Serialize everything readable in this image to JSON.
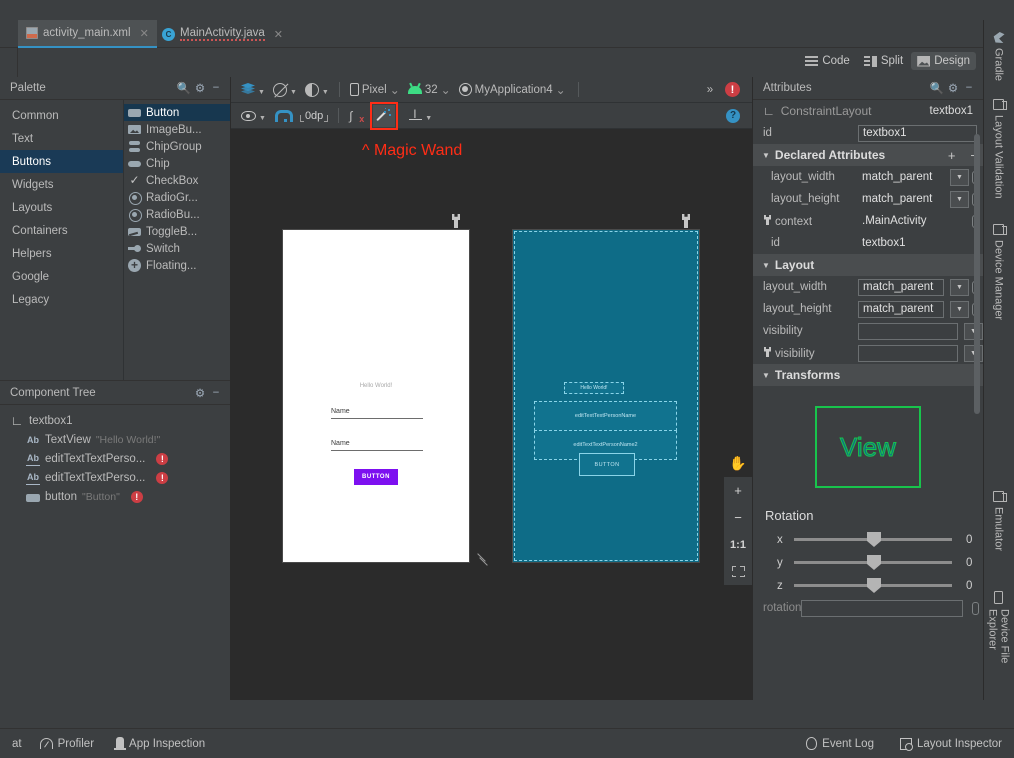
{
  "tabs": [
    {
      "label": "activity_main.xml",
      "icon": "xml-file-icon",
      "active": true
    },
    {
      "label": "MainActivity.java",
      "icon": "java-class-icon",
      "active": false
    }
  ],
  "editor_modes": [
    {
      "label": "Code",
      "icon": "code-view-icon",
      "selected": false
    },
    {
      "label": "Split",
      "icon": "split-view-icon",
      "selected": false
    },
    {
      "label": "Design",
      "icon": "design-view-icon",
      "selected": true
    }
  ],
  "palette": {
    "title": "Palette",
    "icons": [
      "search-icon",
      "gear-icon",
      "minimize-icon"
    ],
    "categories": [
      {
        "label": "Common",
        "selected": false
      },
      {
        "label": "Text",
        "selected": false
      },
      {
        "label": "Buttons",
        "selected": true
      },
      {
        "label": "Widgets",
        "selected": false
      },
      {
        "label": "Layouts",
        "selected": false
      },
      {
        "label": "Containers",
        "selected": false
      },
      {
        "label": "Helpers",
        "selected": false
      },
      {
        "label": "Google",
        "selected": false
      },
      {
        "label": "Legacy",
        "selected": false
      }
    ],
    "items": [
      {
        "label": "Button",
        "icon": "button-icon",
        "selected": true
      },
      {
        "label": "ImageBu...",
        "icon": "image-button-icon",
        "selected": false
      },
      {
        "label": "ChipGroup",
        "icon": "chip-group-icon",
        "selected": false
      },
      {
        "label": "Chip",
        "icon": "chip-icon",
        "selected": false
      },
      {
        "label": "CheckBox",
        "icon": "checkbox-icon",
        "selected": false
      },
      {
        "label": "RadioGr...",
        "icon": "radio-group-icon",
        "selected": false
      },
      {
        "label": "RadioBu...",
        "icon": "radio-button-icon",
        "selected": false
      },
      {
        "label": "ToggleB...",
        "icon": "toggle-button-icon",
        "selected": false
      },
      {
        "label": "Switch",
        "icon": "switch-icon",
        "selected": false
      },
      {
        "label": "Floating...",
        "icon": "floating-action-button-icon",
        "selected": false
      }
    ]
  },
  "component_tree": {
    "title": "Component Tree",
    "icons": [
      "gear-icon",
      "minimize-icon"
    ],
    "nodes": [
      {
        "name": "textbox1",
        "value": "",
        "icon": "constraint-layout-icon",
        "level": 0,
        "error": false
      },
      {
        "name": "TextView",
        "value": "\"Hello World!\"",
        "icon": "textview-icon",
        "level": 1,
        "error": false
      },
      {
        "name": "editTextTextPerso...",
        "value": "",
        "icon": "edittext-icon",
        "level": 1,
        "error": true
      },
      {
        "name": "editTextTextPerso...",
        "value": "",
        "icon": "edittext-icon",
        "level": 1,
        "error": true
      },
      {
        "name": "button",
        "value": "\"Button\"",
        "icon": "button-icon",
        "level": 1,
        "error": true
      }
    ]
  },
  "design_toolbar": {
    "row1": [
      {
        "name": "design-surface-mode",
        "icon": "layers-icon",
        "label": ""
      },
      {
        "name": "orientation-toggle",
        "icon": "rotate-icon",
        "label": ""
      },
      {
        "name": "night-mode-toggle",
        "icon": "theme-icon",
        "label": ""
      },
      {
        "name": "device-selector",
        "icon": "phone-icon",
        "label": "Pixel"
      },
      {
        "name": "api-selector",
        "icon": "android-icon",
        "label": "32"
      },
      {
        "name": "theme-selector",
        "icon": "theme-circle-icon",
        "label": "MyApplication4"
      }
    ],
    "overflow_label": "»",
    "error_badge": "!",
    "row2": [
      {
        "name": "view-options",
        "icon": "eye-icon",
        "label": ""
      },
      {
        "name": "autoconnect-toggle",
        "icon": "magnet-icon",
        "label": ""
      },
      {
        "name": "default-margin",
        "icon": "margin-icon",
        "label": "0dp"
      },
      {
        "name": "clear-constraints",
        "icon": "clear-constraints-icon",
        "label": ""
      },
      {
        "name": "infer-constraints",
        "icon": "magic-wand-icon",
        "label": "",
        "highlighted": true
      },
      {
        "name": "baseline-align",
        "icon": "baseline-icon",
        "label": ""
      }
    ],
    "help_badge": "?"
  },
  "annotation": {
    "text": "^ Magic Wand",
    "color": "#ff2d16"
  },
  "preview": {
    "design": {
      "hello_text": "Hello World!",
      "edit1_text": "Name",
      "edit2_text": "Name",
      "button_text": "BUTTON",
      "button_color": "#7d10f0"
    },
    "blueprint": {
      "hello_text": "Hello World!",
      "edit1_text": "editTextTextPersonName",
      "edit2_text": "editTextTextPersonName2",
      "button_text": "BUTTON",
      "background": "#0e6c87"
    },
    "zoom_controls": [
      {
        "label": "✋",
        "name": "pan-tool-button",
        "active": true
      },
      {
        "label": "+",
        "name": "zoom-in-button",
        "active": false
      },
      {
        "label": "−",
        "name": "zoom-out-button",
        "active": false
      },
      {
        "label": "1:1",
        "name": "zoom-actual-size-button",
        "active": false
      },
      {
        "label": "",
        "name": "zoom-to-fit-button",
        "active": false
      }
    ]
  },
  "attributes": {
    "title": "Attributes",
    "icons": [
      "search-icon",
      "gear-icon",
      "minimize-icon"
    ],
    "widget_type": "ConstraintLayout",
    "widget_id": "textbox1",
    "id_row": {
      "label": "id",
      "value": "textbox1"
    },
    "declared": {
      "title": "Declared Attributes",
      "add_label": "+",
      "remove_label": "−",
      "rows": [
        {
          "label": "layout_width",
          "value": "match_parent",
          "dropdown": true,
          "pill": true,
          "wrench": false
        },
        {
          "label": "layout_height",
          "value": "match_parent",
          "dropdown": true,
          "pill": true,
          "wrench": false
        },
        {
          "label": "context",
          "value": ".MainActivity",
          "dropdown": false,
          "pill": true,
          "wrench": true
        },
        {
          "label": "id",
          "value": "textbox1",
          "dropdown": false,
          "pill": false,
          "wrench": false
        }
      ]
    },
    "layout": {
      "title": "Layout",
      "rows": [
        {
          "label": "layout_width",
          "value": "match_parent",
          "dropdown": true,
          "pill": true,
          "wrench": false
        },
        {
          "label": "layout_height",
          "value": "match_parent",
          "dropdown": true,
          "pill": true,
          "wrench": false
        },
        {
          "label": "visibility",
          "value": "",
          "dropdown": true,
          "pill": false,
          "wrench": false
        },
        {
          "label": "visibility",
          "value": "",
          "dropdown": true,
          "pill": false,
          "wrench": true
        }
      ]
    },
    "transforms": {
      "title": "Transforms",
      "view_label": "View",
      "rotation_title": "Rotation",
      "sliders": [
        {
          "axis": "x",
          "value": "0"
        },
        {
          "axis": "y",
          "value": "0"
        },
        {
          "axis": "z",
          "value": "0"
        }
      ],
      "rotation_row_label": "rotation"
    }
  },
  "right_tool_tabs": [
    {
      "label": "Gradle",
      "icon": "gradle-icon"
    },
    {
      "label": "Layout Validation",
      "icon": "layout-validation-icon"
    },
    {
      "label": "Device Manager",
      "icon": "device-manager-icon"
    },
    {
      "label": "Emulator",
      "icon": "emulator-icon"
    },
    {
      "label": "Device File Explorer",
      "icon": "device-file-explorer-icon"
    }
  ],
  "statusbar": {
    "left": [
      {
        "label": "at",
        "icon": ""
      },
      {
        "label": "Profiler",
        "icon": "profiler-icon"
      },
      {
        "label": "App Inspection",
        "icon": "app-inspection-icon"
      }
    ],
    "right": [
      {
        "label": "Event Log",
        "icon": "event-log-icon"
      },
      {
        "label": "Layout Inspector",
        "icon": "layout-inspector-icon"
      }
    ]
  }
}
